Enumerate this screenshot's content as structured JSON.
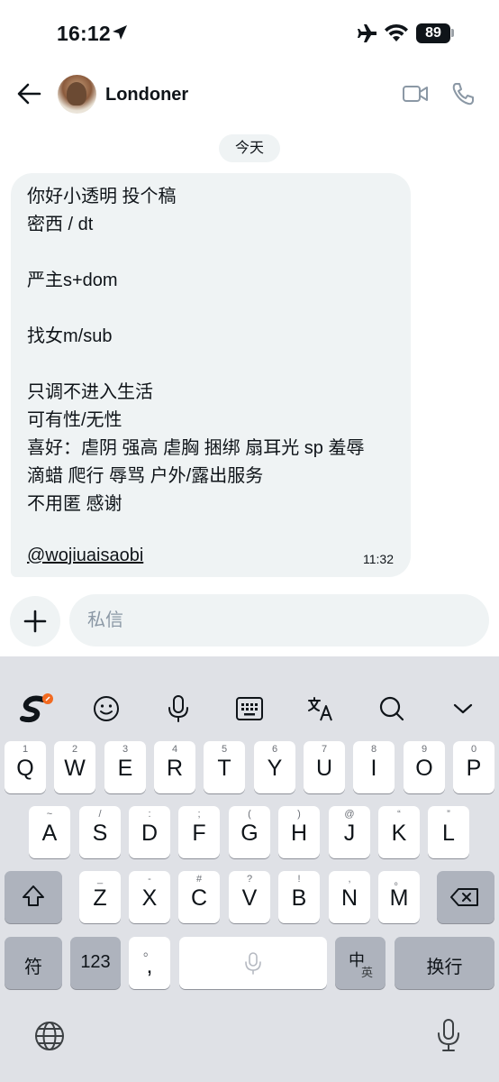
{
  "status_bar": {
    "time": "16:12",
    "battery": "89"
  },
  "header": {
    "contact_name": "Londoner"
  },
  "chat": {
    "date_label": "今天",
    "message": {
      "lines": [
        "你好小透明 投个稿",
        "密西 / dt",
        "",
        "严主s+dom",
        "",
        "找女m/sub",
        "",
        "只调不进入生活",
        "可有性/无性",
        "喜好：虐阴 强高 虐胸 捆绑 扇耳光 sp 羞辱",
        "滴蜡 爬行 辱骂 户外/露出服务",
        "不用匿 感谢"
      ],
      "link": "@wojiuaisaobi",
      "time": "11:32"
    }
  },
  "composer": {
    "placeholder": "私信"
  },
  "keyboard": {
    "row1": [
      {
        "hint": "1",
        "label": "Q"
      },
      {
        "hint": "2",
        "label": "W"
      },
      {
        "hint": "3",
        "label": "E"
      },
      {
        "hint": "4",
        "label": "R"
      },
      {
        "hint": "5",
        "label": "T"
      },
      {
        "hint": "6",
        "label": "Y"
      },
      {
        "hint": "7",
        "label": "U"
      },
      {
        "hint": "8",
        "label": "I"
      },
      {
        "hint": "9",
        "label": "O"
      },
      {
        "hint": "0",
        "label": "P"
      }
    ],
    "row2": [
      {
        "hint": "~",
        "label": "A"
      },
      {
        "hint": "/",
        "label": "S"
      },
      {
        "hint": ":",
        "label": "D"
      },
      {
        "hint": ";",
        "label": "F"
      },
      {
        "hint": "(",
        "label": "G"
      },
      {
        "hint": ")",
        "label": "H"
      },
      {
        "hint": "@",
        "label": "J"
      },
      {
        "hint": "“",
        "label": "K"
      },
      {
        "hint": "”",
        "label": "L"
      }
    ],
    "row3": [
      {
        "hint": "_",
        "label": "Z"
      },
      {
        "hint": "-",
        "label": "X"
      },
      {
        "hint": "#",
        "label": "C"
      },
      {
        "hint": "?",
        "label": "V"
      },
      {
        "hint": "!",
        "label": "B"
      },
      {
        "hint": ",",
        "label": "N"
      },
      {
        "hint": "。",
        "label": "M"
      }
    ],
    "symbols_key": "符",
    "numbers_key": "123",
    "punct_hint": "。",
    "punct_key": ",",
    "lang_key_main": "中",
    "lang_key_sub": "英",
    "return_key": "换行"
  }
}
